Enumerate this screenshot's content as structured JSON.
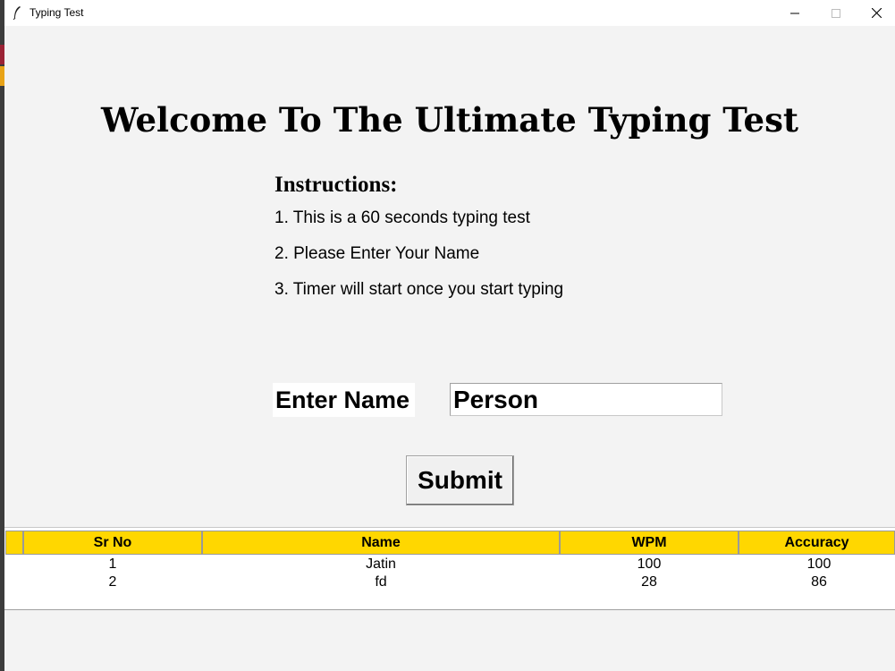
{
  "window": {
    "title": "Typing Test"
  },
  "heading": "Welcome To The Ultimate Typing Test",
  "instructions": {
    "title": "Instructions:",
    "lines": [
      "1. This is a 60 seconds typing test",
      "2. Please Enter Your Name",
      "3. Timer will start once you start typing"
    ]
  },
  "form": {
    "name_label": "Enter Name",
    "name_value": "Person",
    "submit_label": "Submit"
  },
  "table": {
    "headers": [
      "Sr No",
      "Name",
      "WPM",
      "Accuracy"
    ],
    "rows": [
      [
        "1",
        "Jatin",
        "100",
        "100"
      ],
      [
        "2",
        "fd",
        "28",
        "86"
      ]
    ],
    "header_color": "#FFD700"
  }
}
